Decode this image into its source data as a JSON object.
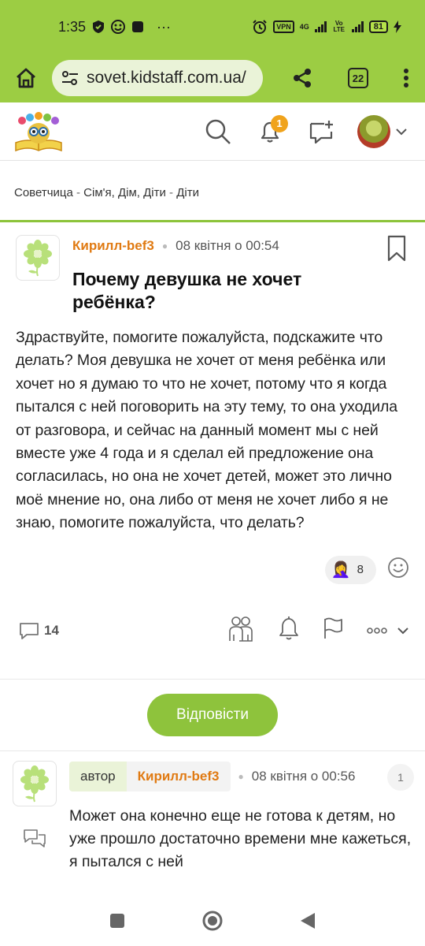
{
  "status_bar": {
    "time": "1:35",
    "vpn": "VPN",
    "network": "4G",
    "volte": "Vo LTE",
    "battery": "81",
    "more": "···"
  },
  "browser": {
    "url": "sovet.kidstaff.com.ua/",
    "tabs_count": "22"
  },
  "header": {
    "notification_count": "1"
  },
  "breadcrumb": {
    "items": [
      "Советчица",
      "Сім'я, Дім, Діти",
      "Діти"
    ],
    "separator": " - "
  },
  "post": {
    "author": "Кирилл-bef3",
    "date": "08 квітня о 00:54",
    "title": "Почему девушка не хочет ребёнка?",
    "body": "Здраствуйте, помогите пожалуйста, подскажите что делать? Моя девушка не хочет от меня ребёнка или хочет но я думаю то что не хочет, потому что я когда пытался с ней поговорить на эту тему, то она уходила от разговора, и сейчас на данный момент мы с ней вместе уже 4 года и я сделал ей предложение она согласилась, но она не хочет детей, может это лично моё мнение но, она либо от меня не хочет либо я не знаю, помогите пожалуйста, что делать?",
    "reaction_emoji": "🤦‍♀️",
    "reaction_count": "8",
    "comment_count": "14"
  },
  "reply_button": "Відповісти",
  "comment": {
    "author_tag": "автор",
    "author": "Кирилл-bef3",
    "date": "08 квітня о 00:56",
    "number": "1",
    "body": "Может она конечно еще не готова к детям, но уже прошло достаточно времени мне кажеться, я пытался с ней"
  },
  "colors": {
    "brand_green": "#9ccd43",
    "accent_orange": "#e07a12",
    "button_green": "#8ec33c"
  }
}
